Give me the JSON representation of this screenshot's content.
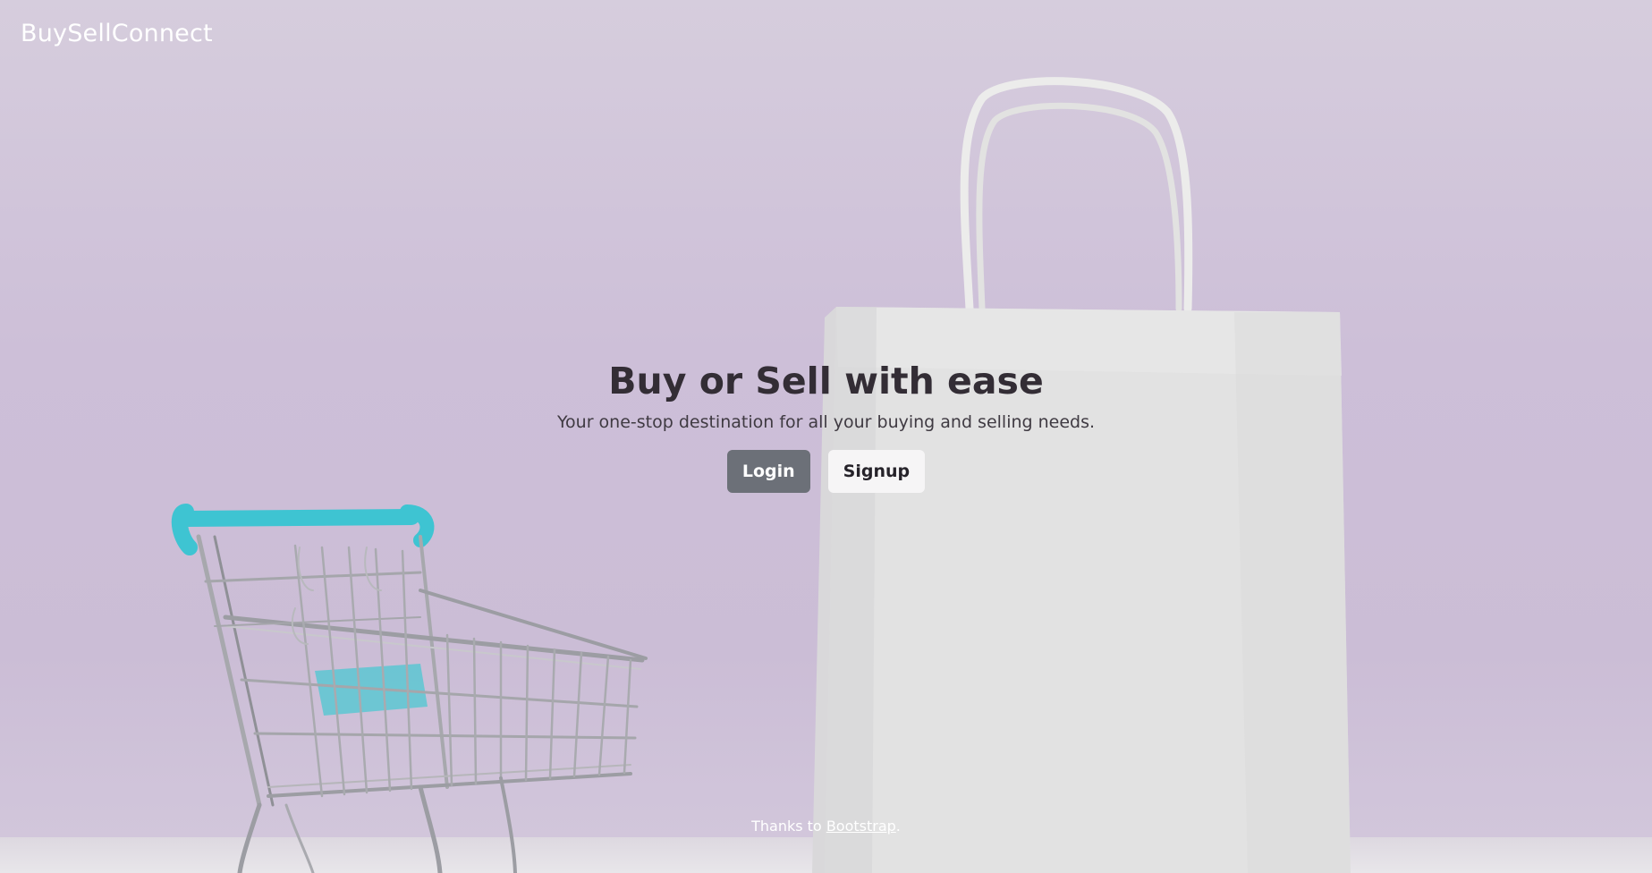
{
  "navbar": {
    "brand": "BuySellConnect"
  },
  "hero": {
    "title": "Buy or Sell with ease",
    "subtitle": "Your one-stop destination for all your buying and selling needs.",
    "login_label": "Login",
    "signup_label": "Signup"
  },
  "footer": {
    "prefix": "Thanks to ",
    "link_label": "Bootstrap",
    "suffix": "."
  },
  "colors": {
    "background": "#cdbfd8",
    "login_button": "#6c7078",
    "signup_button": "#f6f5f6",
    "title_text": "#332d35",
    "cart_handle": "#41c6d4"
  },
  "icons": [
    "shopping-cart-illustration",
    "shopping-bag-illustration"
  ]
}
